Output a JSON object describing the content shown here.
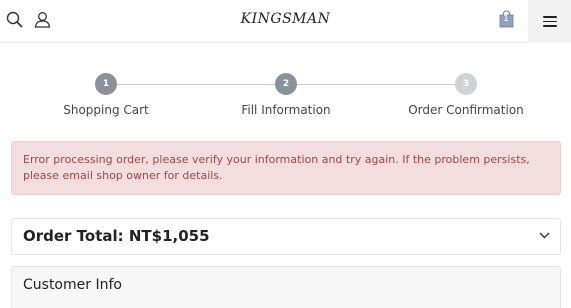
{
  "header": {
    "logo": "KINGSMAN",
    "cart_count": "1",
    "icons": {
      "search": "search-icon",
      "user": "user-icon",
      "cart": "shopping-bag-icon",
      "menu": "hamburger-menu-icon"
    }
  },
  "steps": [
    {
      "number": "1",
      "label": "Shopping Cart",
      "state": "done"
    },
    {
      "number": "2",
      "label": "Fill Information",
      "state": "current"
    },
    {
      "number": "3",
      "label": "Order Confirmation",
      "state": "pending"
    }
  ],
  "alert": {
    "message": "Error processing order, please verify your information and try again. If the problem persists, please email shop owner for details."
  },
  "order_total": {
    "label": "Order Total: NT$1,055"
  },
  "customer_info": {
    "title": "Customer Info"
  },
  "colors": {
    "step_active": "#8a939b",
    "step_inactive": "#cfd3d6",
    "alert_bg": "#f2dede",
    "alert_text": "#a94442",
    "cart_icon": "#8fa3c0"
  }
}
